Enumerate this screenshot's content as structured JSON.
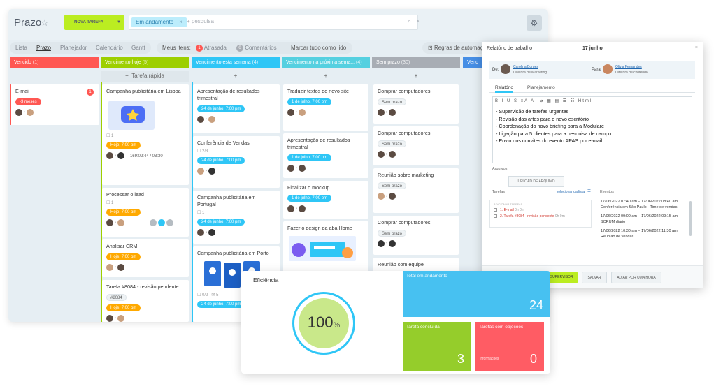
{
  "app": {
    "title": "Prazo",
    "new_task_label": "NOVA TAREFA",
    "filter_chip": "Em andamento",
    "search_placeholder": "+ pesquisa"
  },
  "toolbar": {
    "views": [
      "Lista",
      "Prazo",
      "Planejador",
      "Calendário",
      "Gantt"
    ],
    "my_items_label": "Meus itens:",
    "overdue_count": "1",
    "overdue_label": "Atrasada",
    "comments_count": "0",
    "comments_label": "Comentários",
    "mark_all_read": "Marcar tudo como lido",
    "automation_rules": "Regras de automação"
  },
  "columns": [
    {
      "title": "Vencido",
      "count": "(1)",
      "color": "#ff5752"
    },
    {
      "title": "Vencimento hoje",
      "count": "(5)",
      "color": "#9dcf00"
    },
    {
      "title": "Vencimento esta semana",
      "count": "(4)",
      "color": "#2fc6f6"
    },
    {
      "title": "Vencimento na próxima sema...",
      "count": "(4)",
      "color": "#55d0e0"
    },
    {
      "title": "Sem prazo",
      "count": "(30)",
      "color": "#a8adb4"
    },
    {
      "title": "Venc",
      "count": "",
      "color": "#468ee5"
    }
  ],
  "quick_task_label": "Tarefa rápida",
  "cards": {
    "c0": {
      "title": "E-mail",
      "badge": "1",
      "tag": "-3 meses"
    },
    "c1a": {
      "title": "Campanha publicitária em Lisboa",
      "count": "1",
      "tag": "Hoje, 7:00 pm",
      "timer": "169:02:44 / 03:30"
    },
    "c1b": {
      "title": "Processar o lead",
      "count": "1",
      "tag": "Hoje, 7:00 pm"
    },
    "c1c": {
      "title": "Analisar CRM",
      "tag": "Hoje, 7:00 pm"
    },
    "c1d": {
      "title": "Tarefa #8084 - revisão pendente",
      "tag1": "#8084",
      "tag": "Hoje, 7:00 pm"
    },
    "c2a": {
      "title": "Apresentação de resultados trimestral",
      "tag": "24 de junho, 7:00 pm"
    },
    "c2b": {
      "title": "Conferência de Vendas",
      "count": "2/3",
      "tag": "24 de junho, 7:00 pm"
    },
    "c2c": {
      "title": "Campanha publicitária em Portugal",
      "count": "1",
      "tag": "24 de junho, 7:00 pm"
    },
    "c2d": {
      "title": "Campanha publicitária em Porto",
      "count": "0/2",
      "count2": "5",
      "tag": "24 de junho, 7:00 pm"
    },
    "c3a": {
      "title": "Traduzir textos do novo site",
      "tag": "1 de julho, 7:00 pm"
    },
    "c3b": {
      "title": "Apresentação de resultados trimestral",
      "tag": "1 de julho, 7:00 pm"
    },
    "c3c": {
      "title": "Finalizar o mockup",
      "tag": "1 de julho, 7:00 pm"
    },
    "c3d": {
      "title": "Fazer o design da aba Home"
    },
    "c4a": {
      "title": "Comprar computadores",
      "tag": "Sem prazo"
    },
    "c4b": {
      "title": "Comprar computadores",
      "tag": "Sem prazo"
    },
    "c4c": {
      "title": "Reunião sobre marketing",
      "tag": "Sem prazo"
    },
    "c4d": {
      "title": "Comprar computadores",
      "tag": "Sem prazo"
    },
    "c4e": {
      "title": "Reunião com equipe"
    }
  },
  "report": {
    "title": "Relatório de trabalho",
    "date": "17 junho",
    "from_label": "De:",
    "from_name": "Carolina Borges",
    "from_role": "Diretora de Marketing",
    "to_label": "Para:",
    "to_name": "Olivia Fernandes",
    "to_role": "Diretora de conteúdo",
    "tabs": [
      "Relatório",
      "Planejamento"
    ],
    "editor_tools": "B I U S ≡A A- ⌀ ▦ ▤ ☰ ☷ Html",
    "lines": [
      "- Supervisão de tarefas urgentes",
      "- Revisão das artes para o novo escritório",
      "- Coordenação do novo briefing para a Modulare",
      "- Ligação para 5 clientes para a pesquisa de campo",
      "- Envio dos convites do evento APAS por e-mail"
    ],
    "files_label": "Arquivos",
    "upload_label": "UPLOAD DE ARQUIVO",
    "tasks_label": "Tarefas",
    "select_from_list": "selecionar da lista",
    "events_label": "Eventos",
    "tasks_header": "ADICIONAR TAREFAS",
    "task1_num": "1.",
    "task1": "E-mail",
    "task1_time": "0h 0m",
    "task2": "2. Tarefa #8084 - revisão pendente",
    "task2_time": "0h 0m",
    "events": [
      {
        "time": "17/06/2022 07:40 am  –  17/06/2022 08:40 am",
        "name": "Conferência em São Paulo - Time de vendas"
      },
      {
        "time": "17/06/2022 09:00 am  –  17/06/2022 09:15 am",
        "name": "SCRUM diário"
      },
      {
        "time": "17/06/2022 10:30 am  –  17/06/2022 11:30 am",
        "name": "Reunião de vendas"
      }
    ],
    "btn_send": "ENVIAR PARA SUPERVISOR",
    "btn_save": "SALVAR",
    "btn_postpone": "ADIAR POR UMA HORA"
  },
  "efficiency": {
    "title": "Eficiência",
    "value": "100",
    "unit": "%",
    "total_label": "Total em andamento",
    "total_value": "24",
    "done_label": "Tarefa concluída",
    "done_value": "3",
    "obj_label": "Tarefas com objeções",
    "obj_sub": "Informações",
    "obj_value": "0"
  }
}
